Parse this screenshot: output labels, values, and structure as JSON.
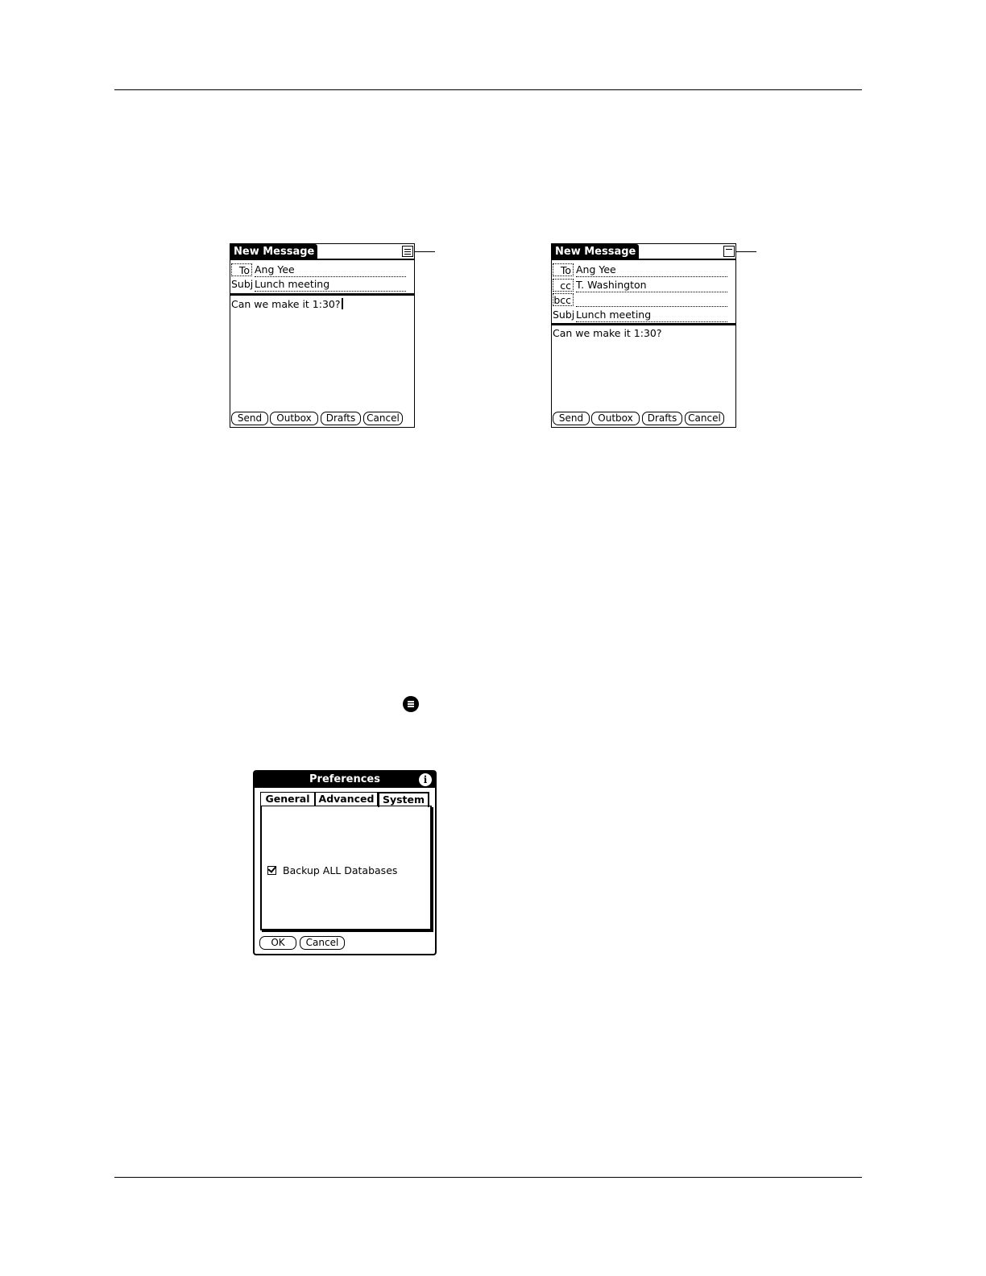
{
  "screen_left": {
    "title": "New Message",
    "fields": [
      {
        "label": "To",
        "value": "Ang Yee"
      },
      {
        "label": "Subj",
        "value": "Lunch meeting"
      }
    ],
    "body": "Can we make it 1:30?",
    "buttons": [
      "Send",
      "Outbox",
      "Drafts",
      "Cancel"
    ],
    "header_icon": "expand-fields-icon"
  },
  "screen_right": {
    "title": "New Message",
    "fields": [
      {
        "label": "To",
        "value": "Ang Yee"
      },
      {
        "label": "cc",
        "value": "T. Washington"
      },
      {
        "label": "bcc",
        "value": ""
      },
      {
        "label": "Subj",
        "value": "Lunch meeting"
      }
    ],
    "body": "Can we make it 1:30?",
    "buttons": [
      "Send",
      "Outbox",
      "Drafts",
      "Cancel"
    ],
    "header_icon": "collapse-fields-icon"
  },
  "menu_icon": "menu-icon",
  "preferences": {
    "title": "Preferences",
    "info_glyph": "i",
    "tabs": [
      "General",
      "Advanced",
      "System"
    ],
    "active_tab": "System",
    "checkbox_label": "Backup ALL Databases",
    "checkbox_checked": true,
    "buttons": [
      "OK",
      "Cancel"
    ]
  }
}
